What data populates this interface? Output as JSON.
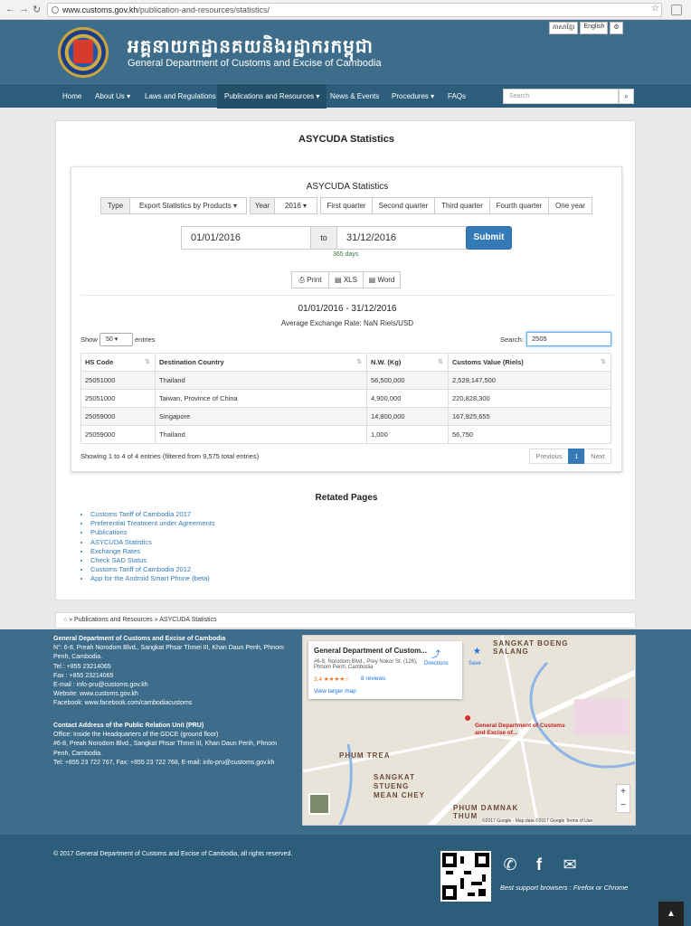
{
  "browser": {
    "url_domain": "www.customs.gov.kh",
    "url_path": "/publication-and-resources/statistics/"
  },
  "header": {
    "khmer_title": "អគ្គនាយកដ្ឋានគយនិងរដ្ឋាករកម្ពុជា",
    "english_title": "General Department of Customs and Excise of Cambodia",
    "languages": [
      "ភាសាខ្មែរ",
      "English"
    ]
  },
  "nav": {
    "items": [
      "Home",
      "About Us ▾",
      "Laws and Regulations",
      "Publications and Resources ▾",
      "News & Events",
      "Procedures ▾",
      "FAQs"
    ],
    "search_placeholder": "Search"
  },
  "page": {
    "title": "ASYCUDA Statistics"
  },
  "panel": {
    "title": "ASYCUDA Statistics",
    "type_label": "Type",
    "type_value": "Export Statistics by Products",
    "year_label": "Year",
    "year_value": "2016",
    "periods": [
      "First quarter",
      "Second quarter",
      "Third quarter",
      "Fourth quarter",
      "One year"
    ],
    "date_from": "01/01/2016",
    "to_label": "to",
    "date_to": "31/12/2016",
    "submit_label": "Submit",
    "days": "365 days",
    "export_buttons": [
      "Print",
      "XLS",
      "Word"
    ],
    "range_title": "01/01/2016 - 31/12/2016",
    "exchange_rate": "Average Exchange Rate: NaN Riels/USD",
    "show_label": "Show",
    "entries_value": "50",
    "entries_label": "entries",
    "search_label": "Search:",
    "search_value": "2505"
  },
  "table": {
    "headers": [
      "HS Code",
      "Destination Country",
      "N.W. (Kg)",
      "Customs Value (Riels)"
    ],
    "rows": [
      [
        "25051000",
        "Thailand",
        "56,500,000",
        "2,529,147,500"
      ],
      [
        "25051000",
        "Taiwan, Province of China",
        "4,900,000",
        "220,828,300"
      ],
      [
        "25059000",
        "Singapore",
        "14,800,000",
        "167,925,655"
      ],
      [
        "25059000",
        "Thailand",
        "1,000",
        "56,750"
      ]
    ],
    "info": "Showing 1 to 4 of 4 entries (filtered from 9,575 total entries)",
    "pagination": [
      "Previous",
      "1",
      "Next"
    ]
  },
  "related": {
    "title": "Retated Pages",
    "links": [
      "Customs Tariff of Cambodia 2017",
      "Preferential Treatment under Agreements",
      "Publications",
      "ASYCUDA Statistics",
      "Exchange Rates",
      "Check SAD Status",
      "Customs Tariff of Cambodia 2012",
      "App for the Android Smart Phone (beta)"
    ]
  },
  "breadcrumb": "» Publications and Resources » ASYCUDA Statistics",
  "footer": {
    "org_title": "General Department of Customs and Excise of Cambodia",
    "org_lines": [
      "N°: 6-8, Preah Norodom Blvd., Sangkat Phsar Thmei III, Khan Daun Penh, Phnom Penh, Cambodia.",
      "Tel : +855 23214065",
      "Fax : +855 23214065",
      "E-mail : info-pru@customs.gov.kh",
      "Website: www.customs.gov.kh",
      "Facebook: www.facebook.com/cambodiacustoms"
    ],
    "pru_title": "Contact Address of the Public Relation Unit (PRU)",
    "pru_lines": [
      "Office: Inside the Headquarters of the GDCE (ground floor)",
      "#6-8, Preah Norodom Blvd., Sangkat Phsar Thmei III, Khan Daun Penh, Phnom Penh, Cambodia.",
      "Tel: +855 23 722 767, Fax: +855 23 722 768, E-mail: info-pru@customs.gov.kh"
    ],
    "map": {
      "place_name": "General Department of Custom...",
      "address": "#6-8, Norodom Blvd., Prey Nokor St. (126), Phnom Penh, Cambodia",
      "rating": "3.4 ★★★★☆",
      "reviews": "8 reviews",
      "view_larger": "View larger map",
      "directions": "Directions",
      "save": "Save",
      "pin_label": "General Department of Customs and Excise of...",
      "labels": [
        "SANGKAT BOENG SALANG",
        "PHUM TREA",
        "SANGKAT STUENG MEAN CHEY",
        "PHUM DAMNAK THUM"
      ],
      "attribution": "©2017 Google - Map data ©2017 Google   Terms of Use"
    },
    "copyright": "© 2017 General Department of Customs and Excise of Cambodia, all rights reserved.",
    "browsers": "Best support browsers : Firefox or Chrome"
  },
  "colors": {
    "header": "#3d6d8a",
    "navbar": "#2c5e7c",
    "primary": "#337ab7"
  }
}
